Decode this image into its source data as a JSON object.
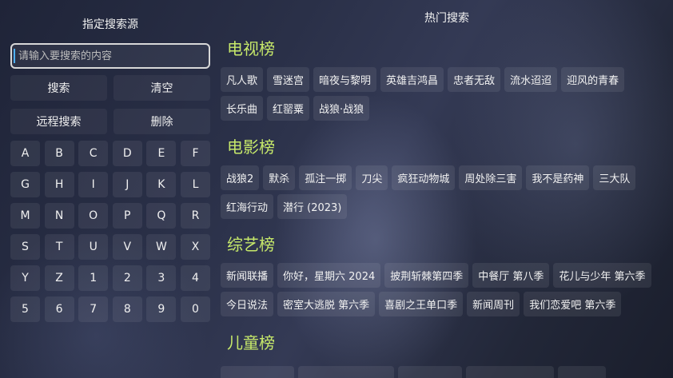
{
  "left": {
    "source_label": "指定搜索源",
    "search_placeholder": "请输入要搜索的内容",
    "search_button": "搜索",
    "clear_button": "清空",
    "remote_search_button": "远程搜索",
    "delete_button": "删除",
    "keys": [
      "A",
      "B",
      "C",
      "D",
      "E",
      "F",
      "G",
      "H",
      "I",
      "J",
      "K",
      "L",
      "M",
      "N",
      "O",
      "P",
      "Q",
      "R",
      "S",
      "T",
      "U",
      "V",
      "W",
      "X",
      "Y",
      "Z",
      "1",
      "2",
      "3",
      "4",
      "5",
      "6",
      "7",
      "8",
      "9",
      "0"
    ]
  },
  "right": {
    "title": "热门搜索",
    "sections": [
      {
        "title": "电视榜",
        "items": [
          "凡人歌",
          "雪迷宫",
          "暗夜与黎明",
          "英雄吉鸿昌",
          "忠者无敌",
          "流水迢迢",
          "迎风的青春",
          "长乐曲",
          "红罂粟",
          "战狼·战狼"
        ]
      },
      {
        "title": "电影榜",
        "items": [
          "战狼2",
          "默杀",
          "孤注一掷",
          "刀尖",
          "疯狂动物城",
          "周处除三害",
          "我不是药神",
          "三大队",
          "红海行动",
          "潜行 (2023)"
        ]
      },
      {
        "title": "综艺榜",
        "items": [
          "新闻联播",
          "你好，星期六 2024",
          "披荆斩棘第四季",
          "中餐厅 第八季",
          "花儿与少年 第六季",
          "今日说法",
          "密室大逃脱 第六季",
          "喜剧之王单口季",
          "新闻周刊",
          "我们恋爱吧 第六季"
        ]
      },
      {
        "title": "儿童榜",
        "items": []
      }
    ]
  }
}
